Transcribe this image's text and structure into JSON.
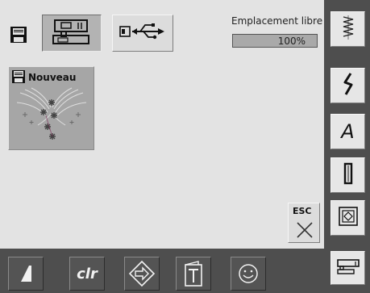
{
  "header": {
    "memory_label": "Emplacement libre",
    "memory_percent": "100%",
    "memory_fill": 1.0
  },
  "sources": [
    {
      "name": "machine-memory",
      "icon": "sewing-machine-icon",
      "selected": true
    },
    {
      "name": "usb-stick",
      "icon": "usb-icon",
      "selected": false
    }
  ],
  "tiles": [
    {
      "label": "Nouveau",
      "icon": "floppy-disk-icon",
      "thumbnail": "embroidery-design-thumbnail"
    }
  ],
  "esc": {
    "label": "ESC"
  },
  "sidebar": {
    "items": [
      {
        "name": "practical-stitches",
        "icon": "zigzag-stitch-icon"
      },
      {
        "name": "decorative-stitches",
        "icon": "decorative-stitch-icon"
      },
      {
        "name": "alphabets",
        "icon": "letter-a-icon",
        "label": "A"
      },
      {
        "name": "buttonholes",
        "icon": "buttonhole-icon"
      },
      {
        "name": "quilt-stitches",
        "icon": "quilt-icon"
      },
      {
        "name": "setup",
        "icon": "sewing-machine-setup-icon"
      }
    ]
  },
  "bottombar": {
    "items": [
      {
        "name": "stitch-width",
        "icon": "width-wedge-icon"
      },
      {
        "name": "clear",
        "icon": "clr-icon",
        "label": "clr"
      },
      {
        "name": "personal-program",
        "icon": "diamond-arrow-icon"
      },
      {
        "name": "tutorial",
        "icon": "tutorial-book-icon"
      },
      {
        "name": "help",
        "icon": "smiley-icon"
      }
    ]
  }
}
